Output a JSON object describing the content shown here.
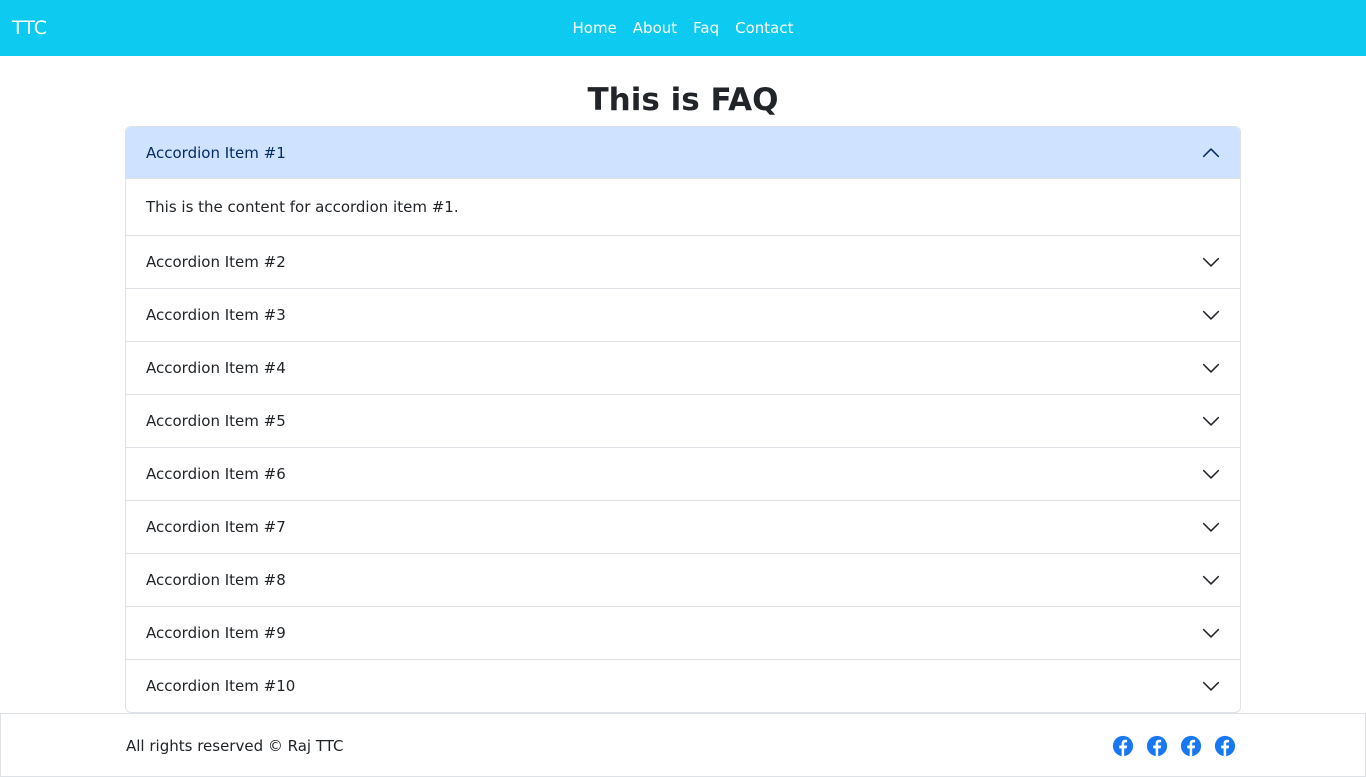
{
  "navbar": {
    "brand": "TTC",
    "links": [
      "Home",
      "About",
      "Faq",
      "Contact"
    ],
    "bg_color": "#0dcaf0"
  },
  "page": {
    "title": "This is FAQ"
  },
  "accordion": {
    "items": [
      {
        "title": "Accordion Item #1",
        "body": "This is the content for accordion item #1.",
        "expanded": true
      },
      {
        "title": "Accordion Item #2",
        "expanded": false
      },
      {
        "title": "Accordion Item #3",
        "expanded": false
      },
      {
        "title": "Accordion Item #4",
        "expanded": false
      },
      {
        "title": "Accordion Item #5",
        "expanded": false
      },
      {
        "title": "Accordion Item #6",
        "expanded": false
      },
      {
        "title": "Accordion Item #7",
        "expanded": false
      },
      {
        "title": "Accordion Item #8",
        "expanded": false
      },
      {
        "title": "Accordion Item #9",
        "expanded": false
      },
      {
        "title": "Accordion Item #10",
        "expanded": false
      }
    ],
    "active_bg": "#cfe2ff",
    "chevron_icon_expanded": "chevron-up-icon",
    "chevron_icon_collapsed": "chevron-down-icon"
  },
  "footer": {
    "copyright": "All rights reserved © Raj TTC",
    "social_icons": [
      "facebook-icon",
      "facebook-icon",
      "facebook-icon",
      "facebook-icon"
    ],
    "social_color": "#1877f2"
  }
}
